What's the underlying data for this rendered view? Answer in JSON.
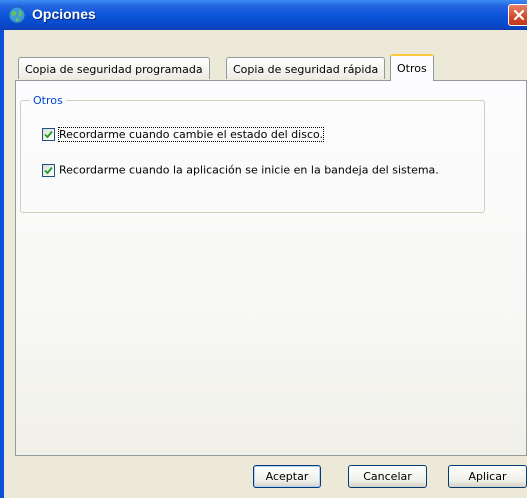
{
  "window": {
    "title": "Opciones",
    "accent": "#0a50d8"
  },
  "tabs": [
    {
      "label": "Copia de seguridad programada"
    },
    {
      "label": "Copia de seguridad rápida"
    },
    {
      "label": "Otros"
    }
  ],
  "active_tab": "Otros",
  "group": {
    "title": "Otros",
    "options": [
      {
        "label": "Recordarme cuando cambie el estado del disco.",
        "checked": true
      },
      {
        "label": "Recordarme cuando la aplicación se inicie en la bandeja del sistema.",
        "checked": true
      }
    ]
  },
  "buttons": {
    "accept": "Aceptar",
    "cancel": "Cancelar",
    "apply": "Aplicar"
  },
  "icons": {
    "app": "app-globe-icon",
    "close": "close-icon",
    "check": "checkmark-icon"
  }
}
